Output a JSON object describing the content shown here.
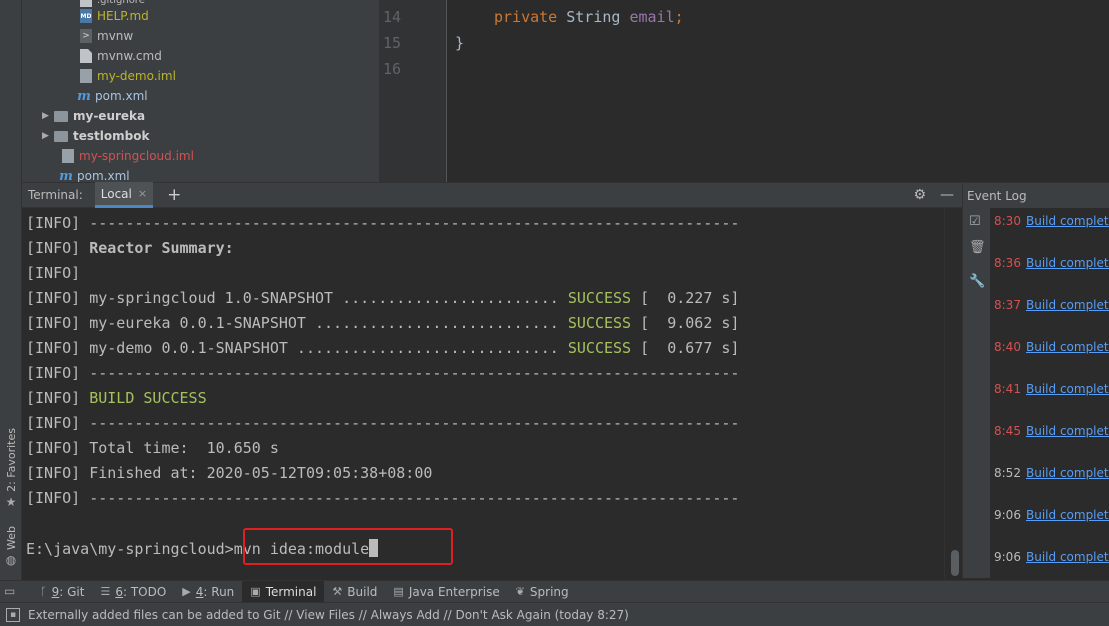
{
  "project_tree": {
    "items": [
      {
        "label": "HELP.md"
      },
      {
        "label": "mvnw"
      },
      {
        "label": "mvnw.cmd"
      },
      {
        "label": "my-demo.iml"
      },
      {
        "label": "pom.xml"
      },
      {
        "label": "my-eureka"
      },
      {
        "label": "testlombok"
      },
      {
        "label": "my-springcloud.iml"
      },
      {
        "label": "pom.xml"
      }
    ]
  },
  "editor": {
    "line_numbers": [
      "14",
      "15",
      "16"
    ],
    "line14_kw": "private",
    "line14_type": " String ",
    "line14_field": "email",
    "line14_end": ";",
    "line15": "}"
  },
  "terminal": {
    "title": "Terminal:",
    "tab_label": "Local",
    "lines": {
      "l0": "[INFO] ------------------------------------------------------------------------",
      "l1_a": "[INFO] ",
      "l1_b": "Reactor Summary:",
      "l2": "[INFO]",
      "l3_a": "[INFO] my-springcloud 1.0-SNAPSHOT ........................ ",
      "l3_ok": "SUCCESS",
      "l3_b": " [  0.227 s]",
      "l4_a": "[INFO] my-eureka 0.0.1-SNAPSHOT ........................... ",
      "l4_ok": "SUCCESS",
      "l4_b": " [  9.062 s]",
      "l5_a": "[INFO] my-demo 0.0.1-SNAPSHOT ............................. ",
      "l5_ok": "SUCCESS",
      "l5_b": " [  0.677 s]",
      "l6": "[INFO] ------------------------------------------------------------------------",
      "l7_a": "[INFO] ",
      "l7_ok": "BUILD SUCCESS",
      "l8": "[INFO] ------------------------------------------------------------------------",
      "l9": "[INFO] Total time:  10.650 s",
      "l10": "[INFO] Finished at: 2020-05-12T09:05:38+08:00",
      "l11": "[INFO] ------------------------------------------------------------------------",
      "prompt": "E:\\java\\my-springcloud>",
      "command": "mvn idea:module"
    }
  },
  "event_log": {
    "title": "Event Log",
    "entries": [
      {
        "time": "8:30",
        "text": "Build completed"
      },
      {
        "time": "8:36",
        "text": "Build completed"
      },
      {
        "time": "8:37",
        "text": "Build completed"
      },
      {
        "time": "8:40",
        "text": "Build completed"
      },
      {
        "time": "8:41",
        "text": "Build completed"
      },
      {
        "time": "8:45",
        "text": "Build completed"
      },
      {
        "time": "8:52",
        "text": "Build completed"
      },
      {
        "time": "9:06",
        "text": "Build completed"
      },
      {
        "time": "9:06",
        "text": "Build completed"
      }
    ]
  },
  "side_tabs": {
    "favorites": "2: Favorites",
    "web": "Web"
  },
  "tool_windows": {
    "git_num": "9",
    "git_label": ": Git",
    "todo_num": "6",
    "todo_label": ": TODO",
    "run_num": "4",
    "run_label": ": Run",
    "terminal": "Terminal",
    "build": "Build",
    "java_enterprise": "Java Enterprise",
    "spring": "Spring"
  },
  "status_bar": {
    "message": "Externally added files can be added to Git // View Files // Always Add // Don't Ask Again (today 8:27)"
  },
  "colors": {
    "success_green": "#a5c25c",
    "highlight_red": "#e02020",
    "link_blue": "#589df6"
  }
}
